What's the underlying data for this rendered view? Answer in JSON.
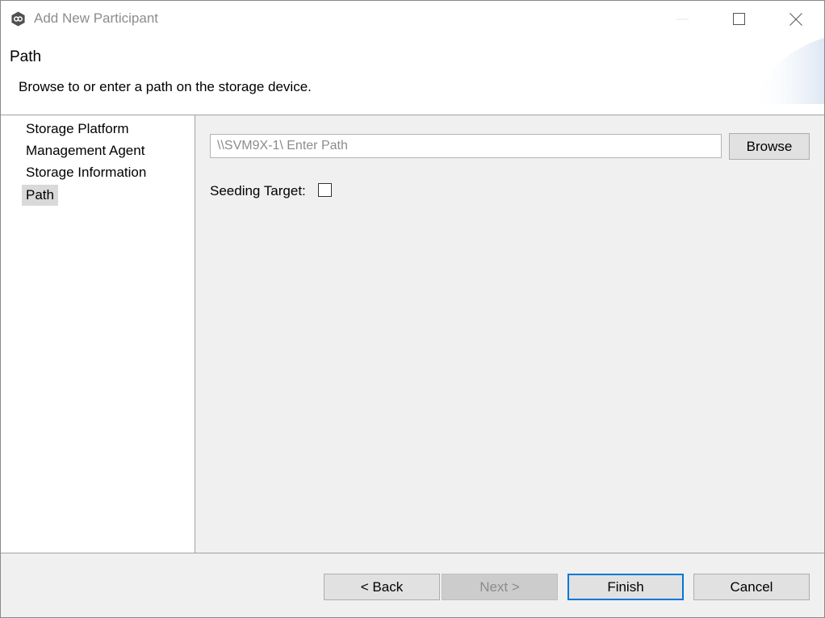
{
  "window": {
    "title": "Add New Participant",
    "app_icon": "participant-logo-icon"
  },
  "header": {
    "title": "Path",
    "description": "Browse to or enter a path on the storage device."
  },
  "nav": {
    "items": [
      {
        "label": "Storage Platform",
        "selected": false
      },
      {
        "label": "Management Agent",
        "selected": false
      },
      {
        "label": "Storage Information",
        "selected": false
      },
      {
        "label": "Path",
        "selected": true
      }
    ]
  },
  "content": {
    "path_value": "",
    "path_placeholder": "\\\\SVM9X-1\\ Enter Path",
    "browse_label": "Browse",
    "seeding_label": "Seeding Target:",
    "seeding_checked": false
  },
  "footer": {
    "back_label": "< Back",
    "next_label": "Next >",
    "finish_label": "Finish",
    "cancel_label": "Cancel"
  },
  "colors": {
    "accent": "#0078d7",
    "content_bg": "#f0f0f0",
    "selected_bg": "#d9d9d9",
    "disabled_text": "#8c8c8c"
  }
}
